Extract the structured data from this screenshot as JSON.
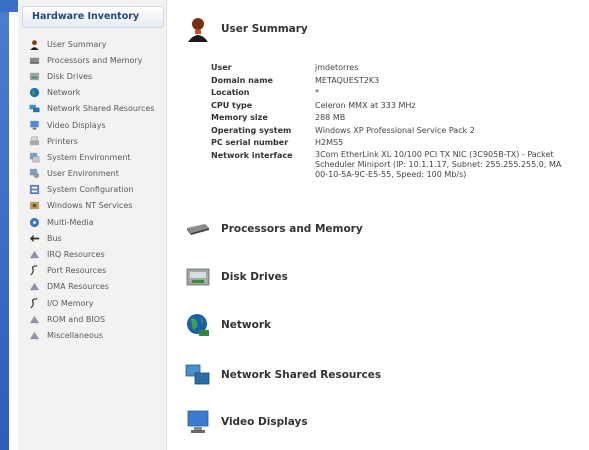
{
  "sidebar": {
    "title": "Hardware Inventory",
    "items": [
      {
        "label": "User Summary",
        "icon": "user-icon"
      },
      {
        "label": "Processors and Memory",
        "icon": "processor-icon"
      },
      {
        "label": "Disk Drives",
        "icon": "disk-icon"
      },
      {
        "label": "Network",
        "icon": "network-globe-icon"
      },
      {
        "label": "Network Shared Resources",
        "icon": "shared-resources-icon"
      },
      {
        "label": "Video Displays",
        "icon": "monitor-icon"
      },
      {
        "label": "Printers",
        "icon": "printer-icon"
      },
      {
        "label": "System Environment",
        "icon": "system-environment-icon"
      },
      {
        "label": "User Environment",
        "icon": "user-environment-icon"
      },
      {
        "label": "System Configuration",
        "icon": "system-config-icon"
      },
      {
        "label": "Windows NT Services",
        "icon": "services-icon"
      },
      {
        "label": "Multi-Media",
        "icon": "multimedia-icon"
      },
      {
        "label": "Bus",
        "icon": "bus-icon"
      },
      {
        "label": "IRQ Resources",
        "icon": "irq-icon"
      },
      {
        "label": "Port Resources",
        "icon": "port-icon"
      },
      {
        "label": "DMA Resources",
        "icon": "dma-icon"
      },
      {
        "label": "I/O Memory",
        "icon": "io-memory-icon"
      },
      {
        "label": "ROM and BIOS",
        "icon": "rom-bios-icon"
      },
      {
        "label": "Miscellaneous",
        "icon": "misc-icon"
      }
    ]
  },
  "main": {
    "user_summary": {
      "title": "User Summary",
      "rows": [
        {
          "key": "User",
          "value": "jmdetorres"
        },
        {
          "key": "Domain name",
          "value": "METAQUEST2K3"
        },
        {
          "key": "Location",
          "value": "*"
        },
        {
          "key": "CPU type",
          "value": "Celeron MMX at 333 MHz"
        },
        {
          "key": "Memory size",
          "value": "288 MB"
        },
        {
          "key": "Operating system",
          "value": "Windows XP Professional Service Pack 2"
        },
        {
          "key": "PC serial number",
          "value": "H2MS5"
        },
        {
          "key": "Network interface",
          "value": "3Com EtherLink XL 10/100 PCI TX NIC (3C905B-TX) - Packet\nScheduler Miniport (IP: 10.1.1.17, Subnet: 255.255.255.0, MA\n00-10-5A-9C-E5-55, Speed: 100 Mb/s)"
        }
      ]
    },
    "sections": [
      {
        "title": "Processors and Memory",
        "icon": "processor-chip-icon"
      },
      {
        "title": "Disk Drives",
        "icon": "disk-drive-icon"
      },
      {
        "title": "Network",
        "icon": "network-globe-icon"
      },
      {
        "title": "Network Shared Resources",
        "icon": "shared-resources-icon"
      },
      {
        "title": "Video Displays",
        "icon": "monitor-icon"
      }
    ]
  },
  "colors": {
    "left_bar": "#2b5fb8",
    "sidebar_bg": "#f2f2f2",
    "header_text": "#24477f"
  }
}
